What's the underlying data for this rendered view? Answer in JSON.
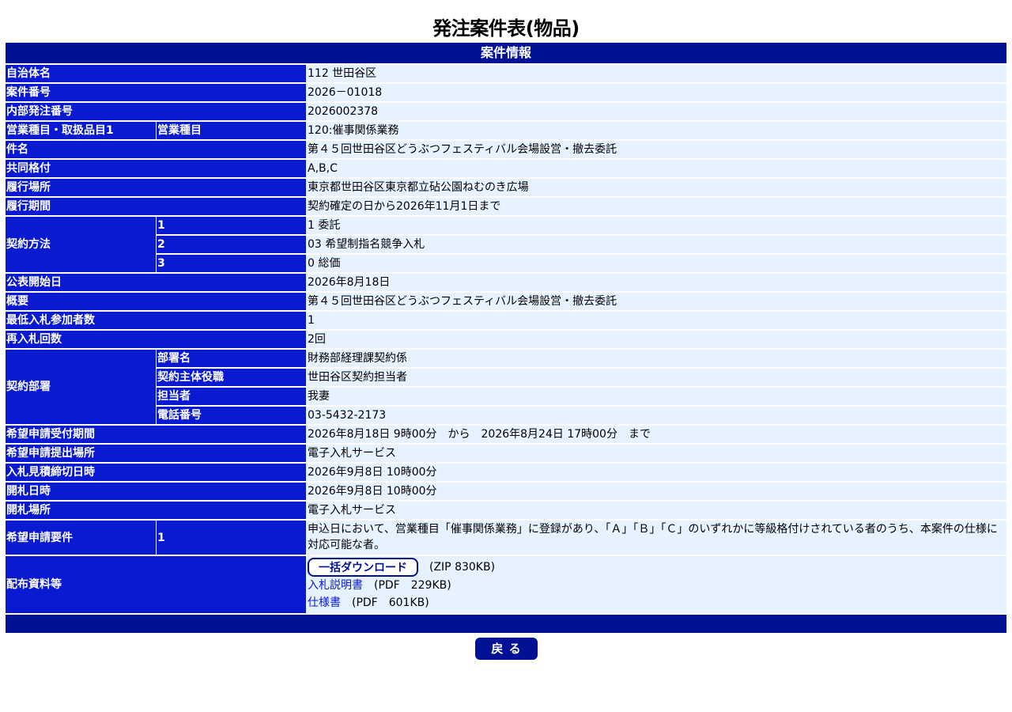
{
  "page": {
    "title": "発注案件表(物品)",
    "section_header": "案件情報",
    "back_button": "戻 る"
  },
  "colors": {
    "header_bg": "#001196",
    "label_bg": "#0a1ad0",
    "value_bg": "#e6f2ff",
    "link": "#0a1ad0"
  },
  "fields": {
    "municipality": {
      "label": "自治体名",
      "value": "112 世田谷区"
    },
    "case_number": {
      "label": "案件番号",
      "value": "2026－01018"
    },
    "internal_order_number": {
      "label": "内部発注番号",
      "value": "2026002378"
    },
    "business_category": {
      "label": "営業種目・取扱品目1",
      "sublabel": "営業種目",
      "value": "120:催事関係業務"
    },
    "subject": {
      "label": "件名",
      "value": "第４５回世田谷区どうぶつフェスティバル会場設営・撤去委託"
    },
    "joint_rating": {
      "label": "共同格付",
      "value": "A,B,C"
    },
    "place": {
      "label": "履行場所",
      "value": "東京都世田谷区東京都立砧公園ねむのき広場"
    },
    "period": {
      "label": "履行期間",
      "value": "契約確定の日から2026年11月1日まで"
    },
    "contract_method": {
      "label": "契約方法",
      "rows": [
        {
          "num": "1",
          "value": "1 委託"
        },
        {
          "num": "2",
          "value": "03 希望制指名競争入札"
        },
        {
          "num": "3",
          "value": "0 総価"
        }
      ]
    },
    "publish_date": {
      "label": "公表開始日",
      "value": "2026年8月18日"
    },
    "summary": {
      "label": "概要",
      "value": "第４５回世田谷区どうぶつフェスティバル会場設営・撤去委託"
    },
    "min_bidders": {
      "label": "最低入札参加者数",
      "value": "1"
    },
    "rebid_count": {
      "label": "再入札回数",
      "value": "2回"
    },
    "contract_department": {
      "label": "契約部署",
      "rows": [
        {
          "sublabel": "部署名",
          "value": "財務部経理課契約係"
        },
        {
          "sublabel": "契約主体役職",
          "value": "世田谷区契約担当者"
        },
        {
          "sublabel": "担当者",
          "value": "我妻"
        },
        {
          "sublabel": "電話番号",
          "value": "03-5432-2173"
        }
      ]
    },
    "application_period": {
      "label": "希望申請受付期間",
      "value": "2026年8月18日 9時00分　から　2026年8月24日 17時00分　まで"
    },
    "application_place": {
      "label": "希望申請提出場所",
      "value": "電子入札サービス"
    },
    "bid_deadline": {
      "label": "入札見積締切日時",
      "value": "2026年9月8日 10時00分"
    },
    "opening_datetime": {
      "label": "開札日時",
      "value": "2026年9月8日 10時00分"
    },
    "opening_place": {
      "label": "開札場所",
      "value": "電子入札サービス"
    },
    "application_requirements": {
      "label": "希望申請要件",
      "num": "1",
      "value": "申込日において、営業種目「催事関係業務」に登録があり、「Ａ」「Ｂ」「Ｃ」のいずれかに等級格付けされている者のうち、本案件の仕様に対応可能な者。"
    },
    "documents": {
      "label": "配布資料等",
      "bulk_download": {
        "label": "一括ダウンロード",
        "meta": "(ZIP 830KB)"
      },
      "files": [
        {
          "name": "入札説明書",
          "meta": "(PDF　229KB)"
        },
        {
          "name": "仕様書",
          "meta": "(PDF　601KB)"
        }
      ]
    }
  }
}
